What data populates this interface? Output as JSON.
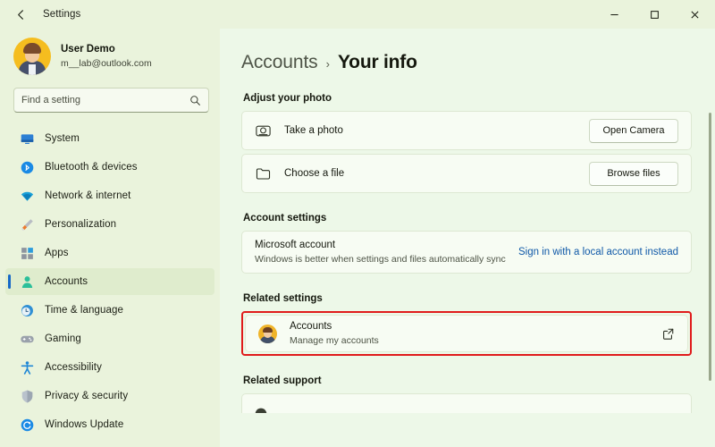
{
  "window": {
    "app_title": "Settings",
    "back_icon": "back-arrow-icon",
    "minimize_label": "—",
    "maximize_label": "□",
    "close_label": "✕"
  },
  "sidebar": {
    "profile": {
      "name": "User Demo",
      "email": "m__lab@outlook.com",
      "avatar_icon": "user-avatar"
    },
    "search": {
      "placeholder": "Find a setting",
      "value": "",
      "icon": "search-icon"
    },
    "items": [
      {
        "label": "System",
        "icon": "monitor-icon",
        "active": false
      },
      {
        "label": "Bluetooth & devices",
        "icon": "bluetooth-icon",
        "active": false
      },
      {
        "label": "Network & internet",
        "icon": "wifi-icon",
        "active": false
      },
      {
        "label": "Personalization",
        "icon": "paintbrush-icon",
        "active": false
      },
      {
        "label": "Apps",
        "icon": "apps-grid-icon",
        "active": false
      },
      {
        "label": "Accounts",
        "icon": "person-icon",
        "active": true
      },
      {
        "label": "Time & language",
        "icon": "clock-globe-icon",
        "active": false
      },
      {
        "label": "Gaming",
        "icon": "gamepad-icon",
        "active": false
      },
      {
        "label": "Accessibility",
        "icon": "accessibility-icon",
        "active": false
      },
      {
        "label": "Privacy & security",
        "icon": "shield-icon",
        "active": false
      },
      {
        "label": "Windows Update",
        "icon": "update-refresh-icon",
        "active": false
      }
    ]
  },
  "content": {
    "breadcrumb": {
      "root": "Accounts",
      "separator": "›",
      "current": "Your info"
    },
    "adjust_photo": {
      "heading": "Adjust your photo",
      "rows": [
        {
          "title": "Take a photo",
          "icon": "camera-icon",
          "button": "Open Camera"
        },
        {
          "title": "Choose a file",
          "icon": "folder-icon",
          "button": "Browse files"
        }
      ]
    },
    "account_settings": {
      "heading": "Account settings",
      "row": {
        "title": "Microsoft account",
        "subtitle": "Windows is better when settings and files automatically sync",
        "link": "Sign in with a local account instead"
      }
    },
    "related_settings": {
      "heading": "Related settings",
      "row": {
        "title": "Accounts",
        "subtitle": "Manage my accounts",
        "icon": "user-avatar",
        "action_icon": "external-link-icon",
        "highlighted": true,
        "highlight_color": "#e01b1b"
      }
    },
    "related_support": {
      "heading": "Related support"
    }
  },
  "colors": {
    "sidebar_bg": "#eaf3dc",
    "content_bg": "#edf8e8",
    "card_bg": "#f7fcf3",
    "accent_selection": "#1668c8",
    "link": "#1059a8",
    "highlight": "#e01b1b"
  }
}
